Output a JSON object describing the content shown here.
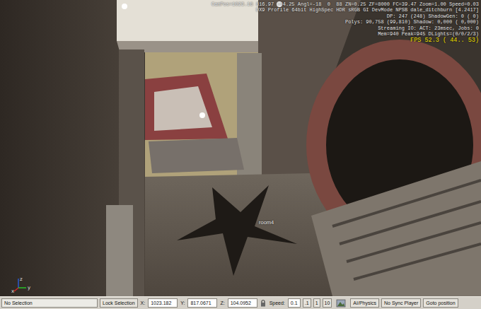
{
  "viewport": {
    "hud": [
      {
        "text": "CamPos=1023.18 816.97 104.25 Angl=-18  0  88 ZN=0.25 ZF=8000 FC=39.47 Zoom=1.00 Speed=0.03",
        "highlight": false
      },
      {
        "text": "DX9 Profile 64bit HighSpec HDR sRGB GI DevMode NPSB dale_ditchburn [4.2417]",
        "highlight": false
      },
      {
        "text": "DP: 247 (248) ShadowGen: 0 ( 0)",
        "highlight": false
      },
      {
        "text": "Polys: 90,758 (99,810) Shadow: 0,000 ( 0,000)",
        "highlight": false
      },
      {
        "text": "Streaming IO: ACT: 23msec, Jobs: 0",
        "highlight": false
      },
      {
        "text": "Mem=940 Peak=945 DLights=(0/0/2/3)",
        "highlight": false
      },
      {
        "text": "FPS 52.3 ( 44.. 53)",
        "highlight": true
      }
    ],
    "label": "room4",
    "axes": {
      "x": "x",
      "y": "y",
      "z": "z"
    }
  },
  "status_bar": {
    "selection": "No Selection",
    "lock_button": "Lock Selection",
    "coords": [
      {
        "label": "X:",
        "value": "1023.182"
      },
      {
        "label": "Y:",
        "value": "817.0671"
      },
      {
        "label": "Z:",
        "value": "104.0952"
      }
    ],
    "speed_label": "Speed:",
    "speed_value": "0.1",
    "speed_presets": [
      ".1",
      "1",
      "10"
    ],
    "buttons": [
      "AI/Physics",
      "No Sync Player",
      "Goto position"
    ]
  }
}
